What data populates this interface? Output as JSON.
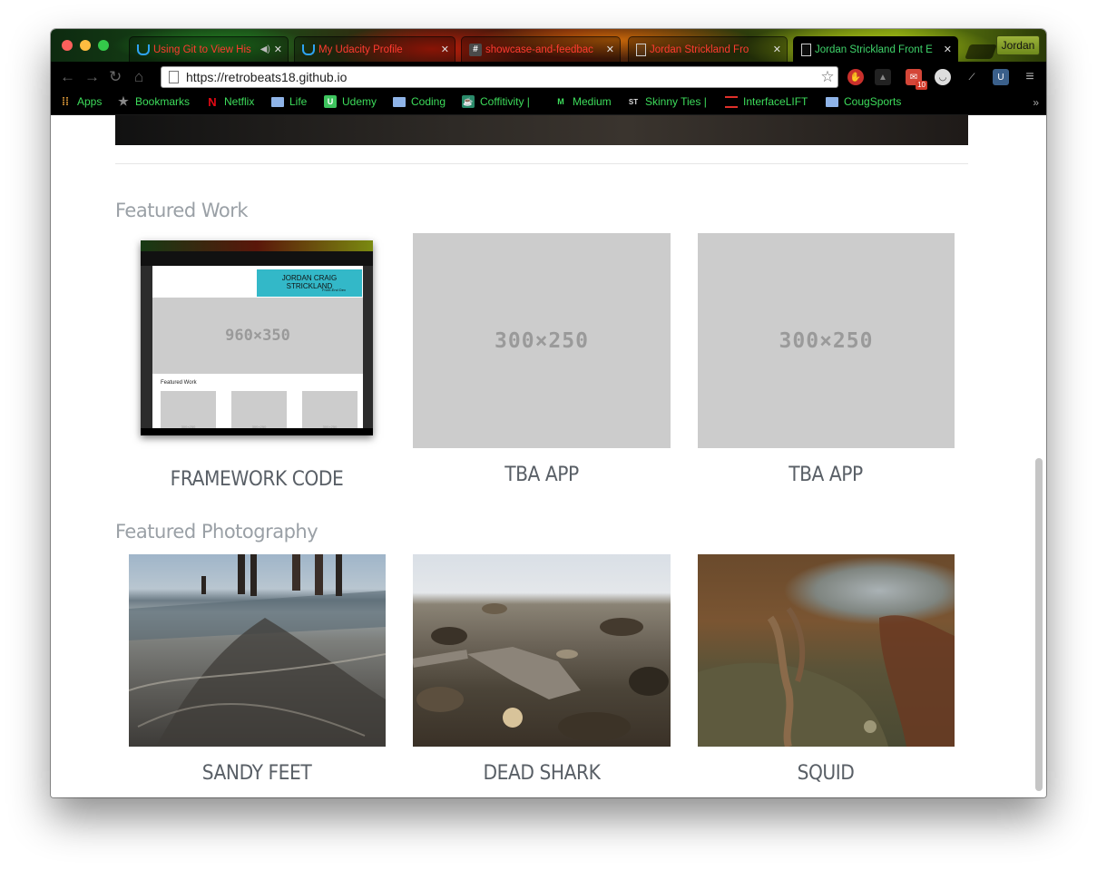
{
  "window": {
    "tabs": [
      {
        "title": "Using Git to View His",
        "favicon": "udacity-icon",
        "audio": true
      },
      {
        "title": "My Udacity Profile",
        "favicon": "udacity-icon"
      },
      {
        "title": "showcase-and-feedbac",
        "favicon": "hash-icon"
      },
      {
        "title": "Jordan Strickland Fro",
        "favicon": "document-icon"
      },
      {
        "title": "Jordan Strickland Front E",
        "favicon": "document-icon",
        "active": true
      }
    ],
    "profile_label": "Jordan"
  },
  "toolbar": {
    "url": "https://retrobeats18.github.io",
    "mail_badge": "10"
  },
  "bookmarks": [
    {
      "label": "Apps",
      "icon": "apps-grid-icon"
    },
    {
      "label": "Bookmarks",
      "icon": "star-icon"
    },
    {
      "label": "Netflix",
      "icon": "netflix-icon"
    },
    {
      "label": "Life",
      "icon": "folder-icon"
    },
    {
      "label": "Udemy",
      "icon": "udemy-icon"
    },
    {
      "label": "Coding",
      "icon": "folder-icon"
    },
    {
      "label": "Coffitivity |",
      "icon": "coffitivity-icon"
    },
    {
      "label": "Medium",
      "icon": "medium-icon"
    },
    {
      "label": "Skinny Ties |",
      "icon": "skinny-ties-icon",
      "icon_text": "ST"
    },
    {
      "label": "InterfaceLIFT",
      "icon": "interfacelift-icon"
    },
    {
      "label": "CougSports",
      "icon": "folder-icon"
    }
  ],
  "page": {
    "featured_work": {
      "title": "Featured Work",
      "items": [
        {
          "caption": "FRAMEWORK CODE",
          "thumbnail": {
            "name": "JORDAN CRAIG STRICKLAND",
            "subtitle": "Front-End Dev",
            "hero": "960×350",
            "section": "Featured Work",
            "boxes": [
              "300×250",
              "300×250",
              "300×250"
            ]
          }
        },
        {
          "caption": "TBA APP",
          "placeholder": "300×250"
        },
        {
          "caption": "TBA APP",
          "placeholder": "300×250"
        }
      ]
    },
    "featured_photography": {
      "title": "Featured Photography",
      "items": [
        {
          "caption": "SANDY FEET"
        },
        {
          "caption": "DEAD SHARK"
        },
        {
          "caption": "SQUID"
        }
      ]
    }
  },
  "colors": {
    "tab_title": "#ff3b30",
    "active_tab_title": "#3fd36a",
    "bookmark_text": "#3ddc5b",
    "heading": "#9aa0a6",
    "caption": "#595f66",
    "placeholder": "#cccccc"
  }
}
